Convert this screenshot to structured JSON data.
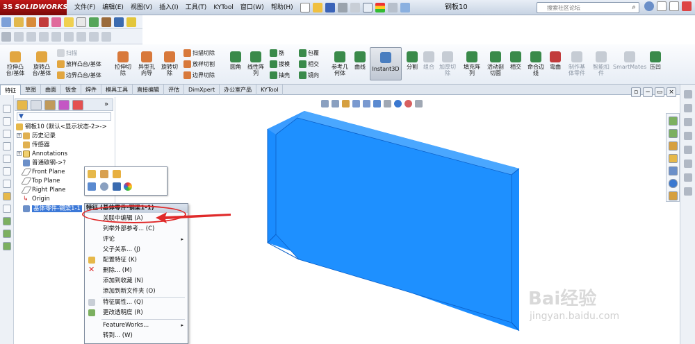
{
  "app": {
    "brand": "SOLIDWORKS",
    "brand_prefix": "3S",
    "document_title": "钢板10"
  },
  "menu": [
    "文件(F)",
    "编辑(E)",
    "视图(V)",
    "插入(I)",
    "工具(T)",
    "KYTool",
    "窗口(W)",
    "帮助(H)"
  ],
  "search": {
    "placeholder": "搜索社区论坛"
  },
  "ribbon": {
    "extrude_boss": "拉伸凸\n台/基体",
    "revolve_boss": "旋转凸\n台/基体",
    "sweep_label": "扫描",
    "loft_boss": "放样凸台/基体",
    "boundary_boss": "边界凸台/基体",
    "extrude_cut": "拉伸切\n除",
    "hole_wizard": "异型孔\n向导",
    "revolve_cut": "旋转切\n除",
    "sweep_cut": "扫描切除",
    "loft_cut": "放样切割",
    "boundary_cut": "边界切除",
    "fillet": "圆角",
    "linear_pattern": "线性阵\n列",
    "rib": "筋",
    "draft": "拔模",
    "shell": "抽壳",
    "wrap": "包覆",
    "intersect": "相交",
    "mirror": "镜向",
    "ref_geometry": "参考几\n何体",
    "curves": "曲线",
    "instant3d": "Instant3D",
    "split": "分割",
    "combine": "组合",
    "thicken_cut": "加厚切\n除",
    "fill_pattern": "填充阵\n列",
    "live_section": "活动剖\n切面",
    "intersect2": "相交",
    "weld_line": "命合边\n线",
    "flex": "弯曲",
    "make_base": "制作基\n体零件",
    "deform": "智能扣\n件",
    "smartmates": "SmartMates",
    "compress": "压凹"
  },
  "tabs": [
    "特征",
    "草图",
    "曲面",
    "钣金",
    "焊件",
    "模具工具",
    "直接编辑",
    "评估",
    "DimXpert",
    "办公室产品",
    "KYTool"
  ],
  "feature_tree": {
    "root": "钢板10  (默认<显示状态-2>->",
    "items": [
      "历史记录",
      "传感器",
      "Annotations",
      "普通碳钢->?",
      "Front Plane",
      "Top Plane",
      "Right Plane",
      "Origin"
    ],
    "selected": "基体零件-钢梁1-1"
  },
  "context_menu": {
    "header": "特征 (基体零件-钢梁1-1)",
    "items": [
      {
        "label": "关联中编辑 (A)",
        "submenu": false
      },
      {
        "label": "列举外部参考... (C)",
        "submenu": false
      },
      {
        "label": "评论",
        "submenu": true
      },
      {
        "label": "父子关系... (J)",
        "submenu": false
      },
      {
        "label": "配置特征 (K)",
        "submenu": false
      },
      {
        "label": "删除... (M)",
        "submenu": false
      },
      {
        "label": "添加到收藏 (N)",
        "submenu": false
      },
      {
        "label": "添加到新文件夹 (O)",
        "submenu": false
      },
      {
        "label": "特征属性... (Q)",
        "submenu": false
      },
      {
        "label": "更改透明度 (R)",
        "submenu": false
      },
      {
        "label": "FeatureWorks...",
        "submenu": true
      },
      {
        "label": "转到... (W)",
        "submenu": false
      }
    ]
  },
  "colors": {
    "part_blue": "#1e90ff",
    "part_edge": "#0a5fc8",
    "callout_red": "#e02a2a",
    "selection": "#3b78d8"
  },
  "watermark": {
    "line1": "Bai经验",
    "line2": "jingyan.baidu.com"
  }
}
